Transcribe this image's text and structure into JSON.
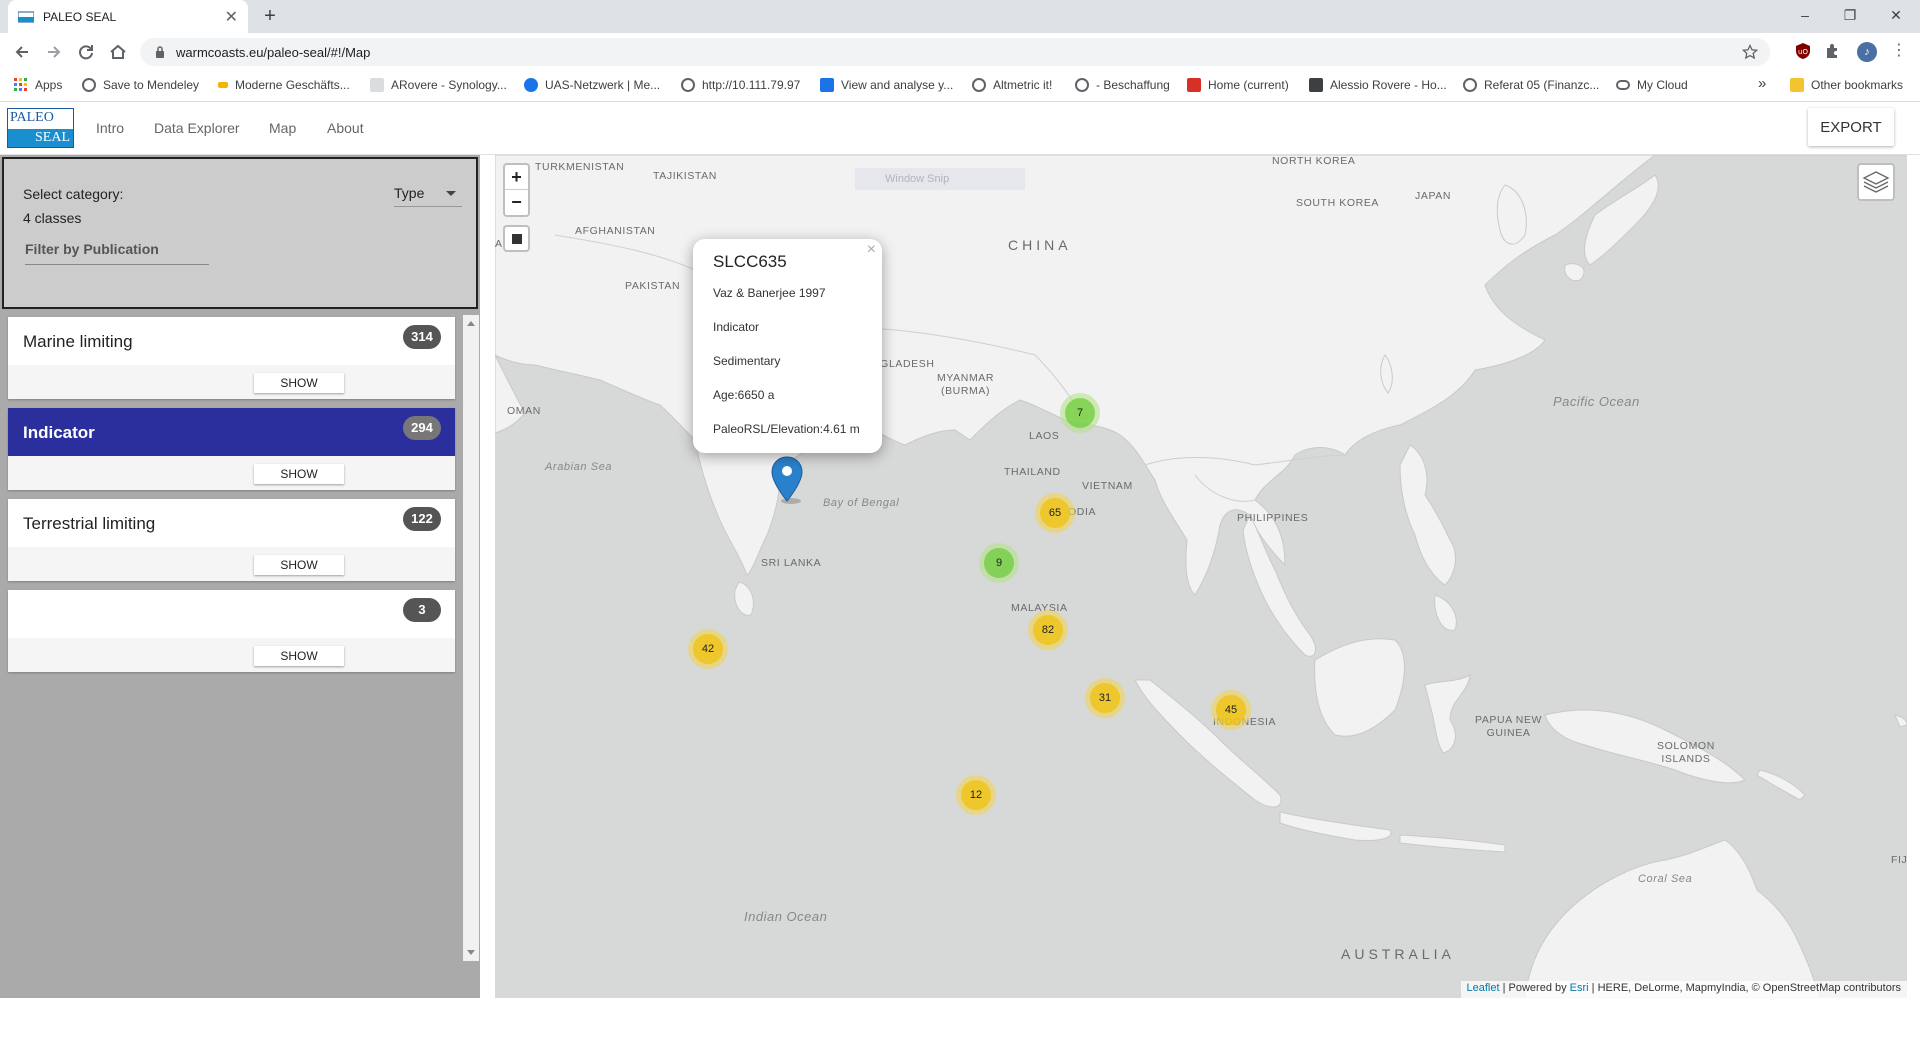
{
  "browser": {
    "tab_title": "PALEO SEAL",
    "url": "warmcoasts.eu/paleo-seal/#!/Map",
    "new_tab": "+",
    "win_min": "–",
    "win_restore": "❐",
    "win_close": "✕",
    "bookmarks": [
      {
        "label": "Apps",
        "color": "#ea4335"
      },
      {
        "label": "Save to Mendeley",
        "color": "#5f6368"
      },
      {
        "label": "Moderne Geschäfts...",
        "color": "#f4b400"
      },
      {
        "label": "ARovere - Synology...",
        "color": "#9aa0a6"
      },
      {
        "label": "UAS-Netzwerk | Me...",
        "color": "#1a73e8"
      },
      {
        "label": "http://10.111.79.97",
        "color": "#5f6368"
      },
      {
        "label": "View and analyse y...",
        "color": "#1a73e8"
      },
      {
        "label": "Altmetric it!",
        "color": "#5f6368"
      },
      {
        "label": "- Beschaffung",
        "color": "#5f6368"
      },
      {
        "label": "Home (current)",
        "color": "#d93025"
      },
      {
        "label": "Alessio Rovere - Ho...",
        "color": "#3c4043"
      },
      {
        "label": "Referat 05 (Finanzc...",
        "color": "#5f6368"
      },
      {
        "label": "My Cloud",
        "color": "#5f6368"
      }
    ],
    "more_bookmarks": "»",
    "other_bookmarks": "Other bookmarks"
  },
  "app": {
    "logo_top": "PALEO",
    "logo_bottom": "SEAL",
    "nav": [
      "Intro",
      "Data Explorer",
      "Map",
      "About"
    ],
    "export_label": "EXPORT"
  },
  "filter": {
    "select_label": "Select category:",
    "classes": "4 classes",
    "type_value": "Type",
    "publication_placeholder": "Filter by Publication"
  },
  "classes": [
    {
      "name": "Marine limiting",
      "count": "314",
      "show": "SHOW"
    },
    {
      "name": "Indicator",
      "count": "294",
      "show": "SHOW"
    },
    {
      "name": "Terrestrial limiting",
      "count": "122",
      "show": "SHOW"
    },
    {
      "name": "",
      "count": "3",
      "show": "SHOW"
    }
  ],
  "map": {
    "zoom_in": "+",
    "zoom_out": "−",
    "ghost_snip": "Window Snip",
    "labels": {
      "turkmenistan": "TURKMENISTAN",
      "tajikistan": "TAJIKISTAN",
      "afghanistan": "AFGHANISTAN",
      "pakistan": "PAKISTAN",
      "iran": "AN",
      "oman": "OMAN",
      "china": "CHINA",
      "north_korea": "NORTH KOREA",
      "south_korea": "SOUTH KOREA",
      "japan": "JAPAN",
      "bangladesh": "NGLADESH",
      "myanmar": "MYANMAR\n(BURMA)",
      "laos": "LAOS",
      "thailand": "THAILAND",
      "vietnam": "VIETNAM",
      "cambodia": "ODIA",
      "philippines": "PHILIPPINES",
      "sri_lanka": "SRI LANKA",
      "malaysia": "MALAYSIA",
      "indonesia": "INDONESIA",
      "papua": "PAPUA NEW\nGUINEA",
      "solomon": "SOLOMON\nISLANDS",
      "australia": "AUSTRALIA",
      "fiji": "FIJI",
      "arabian_sea": "Arabian Sea",
      "bay_of_bengal": "Bay of Bengal",
      "pacific_ocean": "Pacific Ocean",
      "indian_ocean": "Indian Ocean",
      "coral_sea": "Coral Sea"
    },
    "clusters": [
      {
        "count": "7",
        "color": "green"
      },
      {
        "count": "65",
        "color": "yellow"
      },
      {
        "count": "9",
        "color": "green"
      },
      {
        "count": "82",
        "color": "yellow"
      },
      {
        "count": "42",
        "color": "yellow"
      },
      {
        "count": "31",
        "color": "yellow"
      },
      {
        "count": "45",
        "color": "yellow"
      },
      {
        "count": "12",
        "color": "yellow"
      }
    ],
    "popup": {
      "title": "SLCC635",
      "reference": "Vaz & Banerjee 1997",
      "type": "Indicator",
      "category": "Sedimentary",
      "age": "Age:6650 a",
      "elevation": "PaleoRSL/Elevation:4.61 m",
      "close": "×"
    },
    "attribution": {
      "leaflet": "Leaflet",
      "powered": " | Powered by ",
      "esri": "Esri",
      "rest": " | HERE, DeLorme, MapmyIndia, © OpenStreetMap contributors"
    }
  },
  "colors": {
    "active_class": "#2b2f9e",
    "map_land": "#f2f2f2",
    "map_water": "#d7d8d8"
  }
}
